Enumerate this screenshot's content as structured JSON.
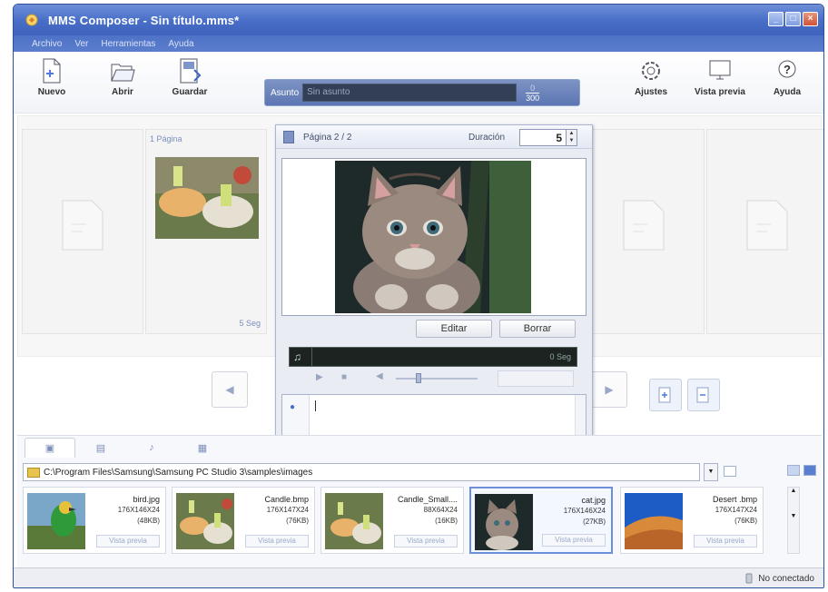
{
  "window": {
    "title": "MMS Composer - Sin título.mms*"
  },
  "menu": [
    "Archivo",
    "Ver",
    "Herramientas",
    "Ayuda"
  ],
  "toolbar": {
    "new_label": "Nuevo",
    "open_label": "Abrir",
    "save_label": "Guardar",
    "settings_label": "Ajustes",
    "preview_label": "Vista previa",
    "help_label": "Ayuda"
  },
  "subject": {
    "label": "Asunto",
    "value": "Sin asunto",
    "counter_top": "0",
    "counter_bottom": "300"
  },
  "editor": {
    "page_label": "Página 2 / 2",
    "duration_label": "Duración",
    "duration_value": "5",
    "edit_button": "Editar",
    "delete_button": "Borrar",
    "audio_seconds": "0 Seg",
    "audio_button": ""
  },
  "page_card": {
    "label": "1 Página",
    "seconds": "5 Seg"
  },
  "bottom": {
    "path": "C:\\Program Files\\Samsung\\Samsung PC Studio 3\\samples\\images",
    "thumbnails": [
      {
        "name": "bird.jpg",
        "dims": "176X146X24",
        "size": "(48KB)",
        "preview": "Vista previa"
      },
      {
        "name": "Candle.bmp",
        "dims": "176X147X24",
        "size": "(76KB)",
        "preview": "Vista previa"
      },
      {
        "name": "Candle_Small....",
        "dims": "88X64X24",
        "size": "(16KB)",
        "preview": "Vista previa"
      },
      {
        "name": "cat.jpg",
        "dims": "176X146X24",
        "size": "(27KB)",
        "preview": "Vista previa"
      },
      {
        "name": "Desert .bmp",
        "dims": "176X147X24",
        "size": "(76KB)",
        "preview": "Vista previa"
      }
    ]
  },
  "status": {
    "connection": "No conectado"
  },
  "colors": {
    "titlebar": "#4a6fc8",
    "accent": "#6b8fd8"
  }
}
